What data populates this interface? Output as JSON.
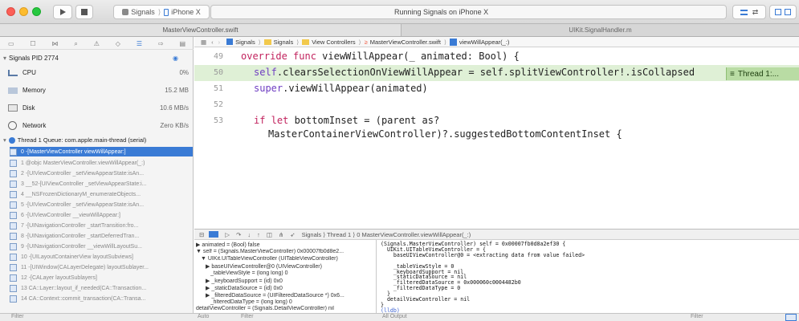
{
  "toolbar": {
    "scheme": "Signals",
    "device": "iPhone X",
    "status": "Running Signals on iPhone X"
  },
  "tabs": {
    "left": "MasterViewController.swift",
    "right": "UIKit.SignalHandler.m"
  },
  "navigator": {
    "process": "Signals PID 2774",
    "gauges": [
      {
        "name": "CPU",
        "value": "0%"
      },
      {
        "name": "Memory",
        "value": "15.2 MB"
      },
      {
        "name": "Disk",
        "value": "10.6 MB/s"
      },
      {
        "name": "Network",
        "value": "Zero KB/s"
      }
    ],
    "thread": "Thread 1 Queue: com.apple.main-thread (serial)",
    "frames": [
      "0 -[MasterViewController viewWillAppear:]",
      "1 @objc MasterViewController.viewWillAppear(_:)",
      "2 -[UIViewController _setViewAppearState:isAn...",
      "3 __52-[UIViewController _setViewAppearState:i...",
      "4 __NSFrozenDictionaryM_enumerateObjects...",
      "5 -[UIViewController _setViewAppearState:isAn...",
      "6 -[UIViewController __viewWillAppear:]",
      "7 -[UINavigationController _startTransition:fro...",
      "8 -[UINavigationController _startDeferredTran...",
      "9 -[UINavigationController __viewWillLayoutSu...",
      "10 -[UILayoutContainerView layoutSubviews]",
      "11 -[UIWindow(CALayerDelegate) layoutSublayer...",
      "12 -[CALayer layoutSublayers]",
      "13 CA::Layer::layout_if_needed(CA::Transaction...",
      "14 CA::Context::commit_transaction(CA::Transa..."
    ],
    "filter": "Filter"
  },
  "jumpbar": [
    "Signals",
    "Signals",
    "View Controllers",
    "MasterViewController.swift",
    "viewWillAppear(_:)"
  ],
  "editor": {
    "lines": [
      {
        "num": "49",
        "kw": "override func ",
        "rest": "viewWillAppear(_ animated: Bool) {"
      },
      {
        "num": "50",
        "kw": "self",
        "rest": ".clearsSelectionOnViewWillAppear = self.splitViewController!.isCollapsed"
      },
      {
        "num": "51",
        "kw": "super",
        "rest": ".viewWillAppear(animated)"
      },
      {
        "num": "52",
        "kw": "",
        "rest": ""
      },
      {
        "num": "53",
        "kw": "if let ",
        "rest": "bottomInset = (parent as?"
      },
      {
        "num": "",
        "kw": "",
        "rest": "MasterContainerViewController)?.suggestedBottomContentInset {"
      }
    ],
    "thread_badge": "Thread 1:..."
  },
  "debugbar": {
    "breadcrumb": "Signals ⟩ Thread 1 ⟩ 0 MasterViewController.viewWillAppear(_:)"
  },
  "variables": [
    "▶ animated = (Bool) false",
    "▼ self = (Signals.MasterViewController) 0x00007fb0d8e2...",
    "▼ UIKit.UITableViewController (UITableViewController)",
    "▶ baseUIViewController@0 (UIViewController)",
    "_tableViewStyle = (long long) 0",
    "▶ _keyboardSupport = (id) 0x0",
    "▶ _staticDataSource = (id) 0x0",
    "▶ _filteredDataSource = (UIFilteredDataSource *) 0x6...",
    "_filteredDataType = (long long) 0",
    "detailViewController = (Signals.DetailViewController) nil"
  ],
  "console": [
    "(Signals.MasterViewController) self = 0x00007fb0d8a2ef30 {",
    "  UIKit.UITableViewController = {",
    "    baseUIViewController@0 = <extracting data from value failed>",
    "",
    "    _tableViewStyle = 0",
    "    _keyboardSupport = nil",
    "    _staticDataSource = nil",
    "    _filteredDataSource = 0x000060c0004482b0",
    "    _filteredDataType = 0",
    "  }",
    "  detailViewController = nil",
    "}",
    "(lldb)"
  ],
  "footer": {
    "left_filter": "Filter",
    "auto": "Auto",
    "mid_filter": "Filter",
    "output": "All Output",
    "right_filter": "Filter"
  }
}
